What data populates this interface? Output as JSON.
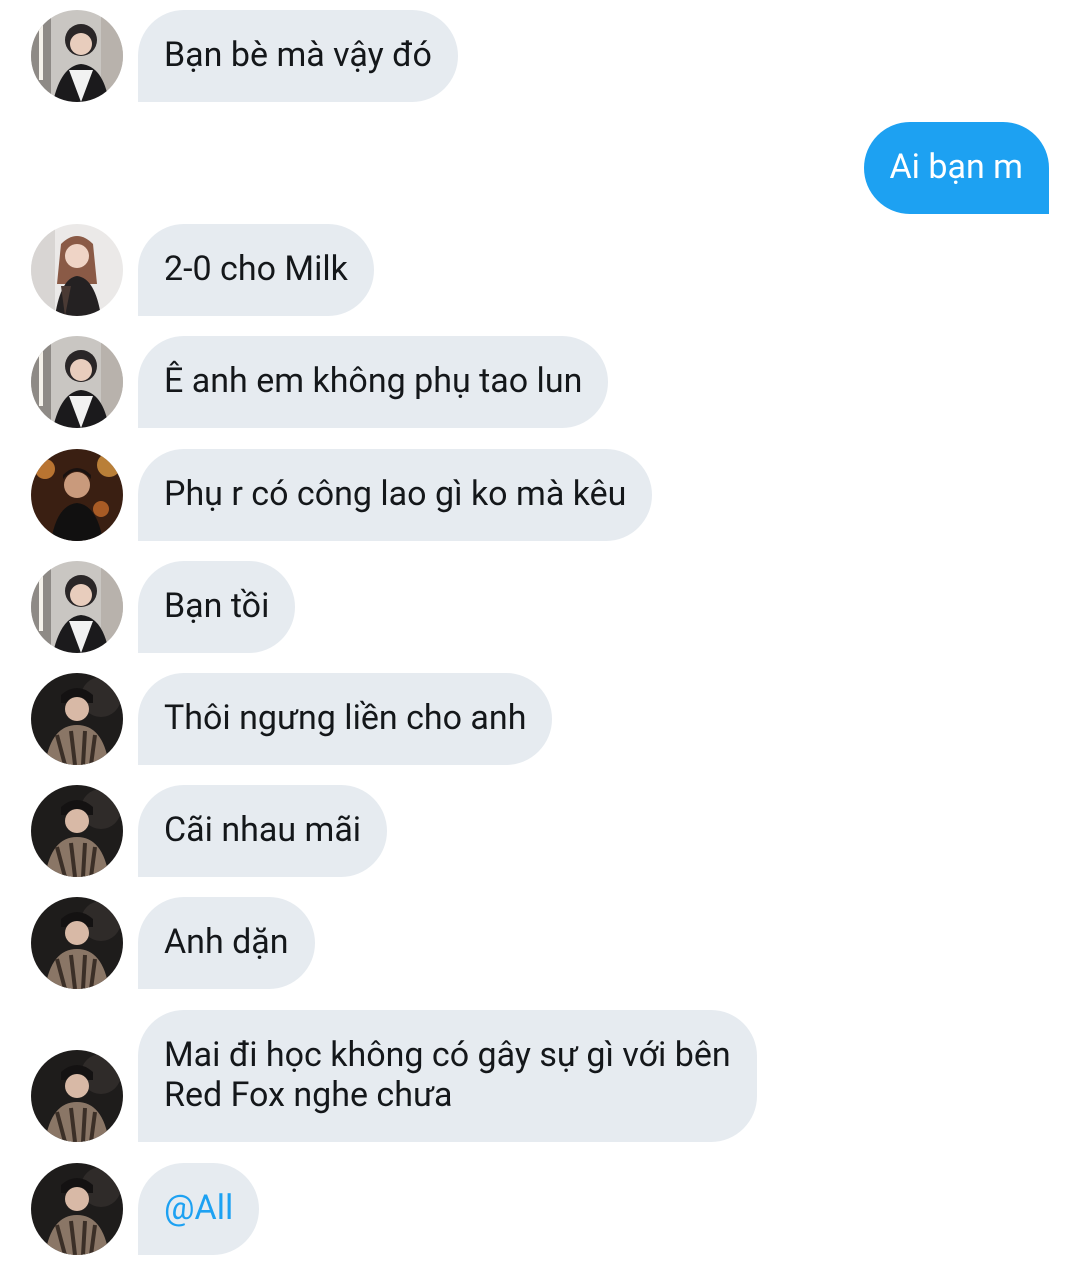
{
  "messages": [
    {
      "text": "Bạn bè mà vậy đó",
      "sender": "user-a",
      "direction": "in"
    },
    {
      "text": "Ai bạn m",
      "sender": "me",
      "direction": "out"
    },
    {
      "text": "2-0 cho Milk",
      "sender": "user-b",
      "direction": "in"
    },
    {
      "text": "Ê anh em không phụ tao lun",
      "sender": "user-a",
      "direction": "in"
    },
    {
      "text": "Phụ r có công lao gì ko mà kêu",
      "sender": "user-c",
      "direction": "in"
    },
    {
      "text": "Bạn tồi",
      "sender": "user-a",
      "direction": "in"
    },
    {
      "text": "Thôi ngưng liền cho anh",
      "sender": "user-d",
      "direction": "in"
    },
    {
      "text": "Cãi nhau mãi",
      "sender": "user-d",
      "direction": "in"
    },
    {
      "text": "Anh dặn",
      "sender": "user-d",
      "direction": "in"
    },
    {
      "text": "Mai đi học không có gây sự gì với bên\nRed Fox nghe chưa",
      "sender": "user-d",
      "direction": "in"
    },
    {
      "text": "@All",
      "sender": "user-d",
      "direction": "in",
      "mention": true
    }
  ],
  "colors": {
    "incoming_bubble": "#e6ebf0",
    "outgoing_bubble": "#1da1f2",
    "mention_text": "#1da1f2",
    "text": "#14171a"
  }
}
